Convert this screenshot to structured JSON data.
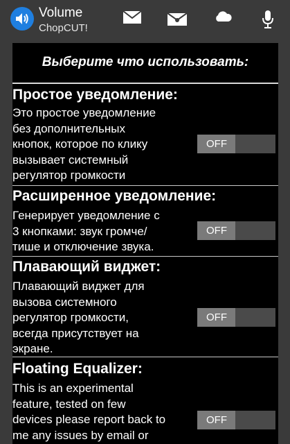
{
  "app": {
    "title": "Volume",
    "subtitle": "ChopCUT!",
    "icon": "speaker-icon",
    "accent_color": "#1f7fe0"
  },
  "actions": [
    {
      "icon": "mail-icon"
    },
    {
      "icon": "open-mail-icon"
    },
    {
      "icon": "cloud-icon"
    },
    {
      "icon": "microphone-icon"
    }
  ],
  "header": {
    "title": "Выберите что использовать:"
  },
  "sections": [
    {
      "title": "Простое уведомление:",
      "description": "Это простое уведомление\nбез дополнительных\nкнопок, которое по клику\nвызывает системный\nрегулятор громкости",
      "toggle_label": "OFF",
      "toggle_on": false
    },
    {
      "title": "Расширенное уведомление:",
      "description": "Генерирует уведомление с\n3 кнопками: звук громче/\nтише и отключение звука.",
      "toggle_label": "OFF",
      "toggle_on": false
    },
    {
      "title": "Плавающий виджет:",
      "description": "Плавающий виджет для\nвызова системного\nрегулятор громкости,\nвсегда присутствует на\nэкране.",
      "toggle_label": "OFF",
      "toggle_on": false
    },
    {
      "title": "Floating Equalizer:",
      "description": "This is an experimental\nfeature, tested on few\ndevices please report back to\nme any issues by email or",
      "toggle_label": "OFF",
      "toggle_on": false
    }
  ]
}
